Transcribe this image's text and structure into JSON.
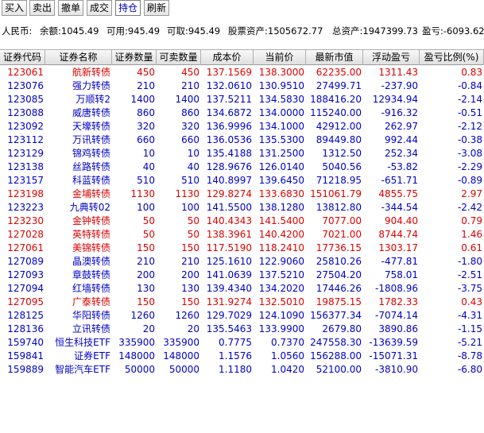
{
  "toolbar": {
    "buttons": [
      "买入",
      "卖出",
      "撤单",
      "成交",
      "持仓",
      "刷新"
    ],
    "active_index": 4
  },
  "account": {
    "currency": "人民币:",
    "balance": "余额:1045.49",
    "available": "可用:945.49",
    "withdrawable": "可取:945.49",
    "stock_assets": "股票资产:1505672.77",
    "total_assets": "总资产:1947399.73",
    "pnl": "盈亏:-6093.62"
  },
  "table": {
    "headers": [
      "证券代码",
      "证券名称",
      "证券数量",
      "可卖数量",
      "成本价",
      "当前价",
      "最新市值",
      "浮动盈亏",
      "盈亏比例(%)"
    ],
    "rows": [
      [
        "123061",
        "航新转债",
        "450",
        "450",
        "137.1569",
        "138.3000",
        "62235.00",
        "1311.43",
        "0.83"
      ],
      [
        "123076",
        "强力转债",
        "210",
        "210",
        "132.0610",
        "130.9510",
        "27499.71",
        "-237.90",
        "-0.84"
      ],
      [
        "123085",
        "万顺转2",
        "1400",
        "1400",
        "137.5211",
        "134.5830",
        "188416.20",
        "12934.94",
        "-2.14"
      ],
      [
        "123088",
        "威唐转债",
        "860",
        "860",
        "134.6872",
        "134.0000",
        "115240.00",
        "-916.32",
        "-0.51"
      ],
      [
        "123092",
        "天壕转债",
        "320",
        "320",
        "136.9996",
        "134.1000",
        "42912.00",
        "262.97",
        "-2.12"
      ],
      [
        "123112",
        "万讯转债",
        "660",
        "660",
        "136.0536",
        "135.5300",
        "89449.80",
        "992.44",
        "-0.38"
      ],
      [
        "123129",
        "锦鸡转债",
        "10",
        "10",
        "135.4188",
        "131.2500",
        "1312.50",
        "252.34",
        "-3.08"
      ],
      [
        "123138",
        "丝路转债",
        "40",
        "40",
        "128.9676",
        "126.0140",
        "5040.56",
        "-53.82",
        "-2.29"
      ],
      [
        "123157",
        "科蓝转债",
        "510",
        "510",
        "140.8997",
        "139.6450",
        "71218.95",
        "-651.71",
        "-0.89"
      ],
      [
        "123198",
        "金埔转债",
        "1130",
        "1130",
        "129.8274",
        "133.6830",
        "151061.79",
        "4855.75",
        "2.97"
      ],
      [
        "123223",
        "九典转02",
        "100",
        "100",
        "141.5500",
        "138.1280",
        "13812.80",
        "-344.54",
        "-2.42"
      ],
      [
        "123230",
        "金钟转债",
        "50",
        "50",
        "140.4343",
        "141.5400",
        "7077.00",
        "904.40",
        "0.79"
      ],
      [
        "127028",
        "英特转债",
        "50",
        "50",
        "138.3961",
        "140.4200",
        "7021.00",
        "8744.74",
        "1.46"
      ],
      [
        "127061",
        "美锦转债",
        "150",
        "150",
        "117.5190",
        "118.2410",
        "17736.15",
        "1303.17",
        "0.61"
      ],
      [
        "127089",
        "晶澳转债",
        "210",
        "210",
        "125.1610",
        "122.9060",
        "25810.26",
        "-477.81",
        "-1.80"
      ],
      [
        "127093",
        "章鼓转债",
        "200",
        "200",
        "141.0639",
        "137.5210",
        "27504.20",
        "758.01",
        "-2.51"
      ],
      [
        "127094",
        "红墙转债",
        "130",
        "130",
        "139.4340",
        "134.2020",
        "17446.26",
        "-1808.96",
        "-3.75"
      ],
      [
        "127095",
        "广泰转债",
        "150",
        "150",
        "131.9274",
        "132.5010",
        "19875.15",
        "1782.33",
        "0.43"
      ],
      [
        "128125",
        "华阳转债",
        "1260",
        "1260",
        "129.7029",
        "124.1090",
        "156377.34",
        "-7074.14",
        "-4.31"
      ],
      [
        "128136",
        "立讯转债",
        "20",
        "20",
        "135.5463",
        "133.9900",
        "2679.80",
        "3890.86",
        "-1.15"
      ],
      [
        "159740",
        "恒生科技ETF",
        "335900",
        "335900",
        "0.7775",
        "0.7370",
        "247558.30",
        "-13639.59",
        "-5.21"
      ],
      [
        "159841",
        "证券ETF",
        "148000",
        "148000",
        "1.1576",
        "1.0560",
        "156288.00",
        "-15071.31",
        "-8.78"
      ],
      [
        "159889",
        "智能汽车ETF",
        "50000",
        "50000",
        "1.1180",
        "1.0420",
        "52100.00",
        "-3810.90",
        "-6.80"
      ]
    ]
  },
  "colors": {
    "positive": "#e00000",
    "negative": "#0000c8",
    "active_button_text": "#0000c8"
  }
}
